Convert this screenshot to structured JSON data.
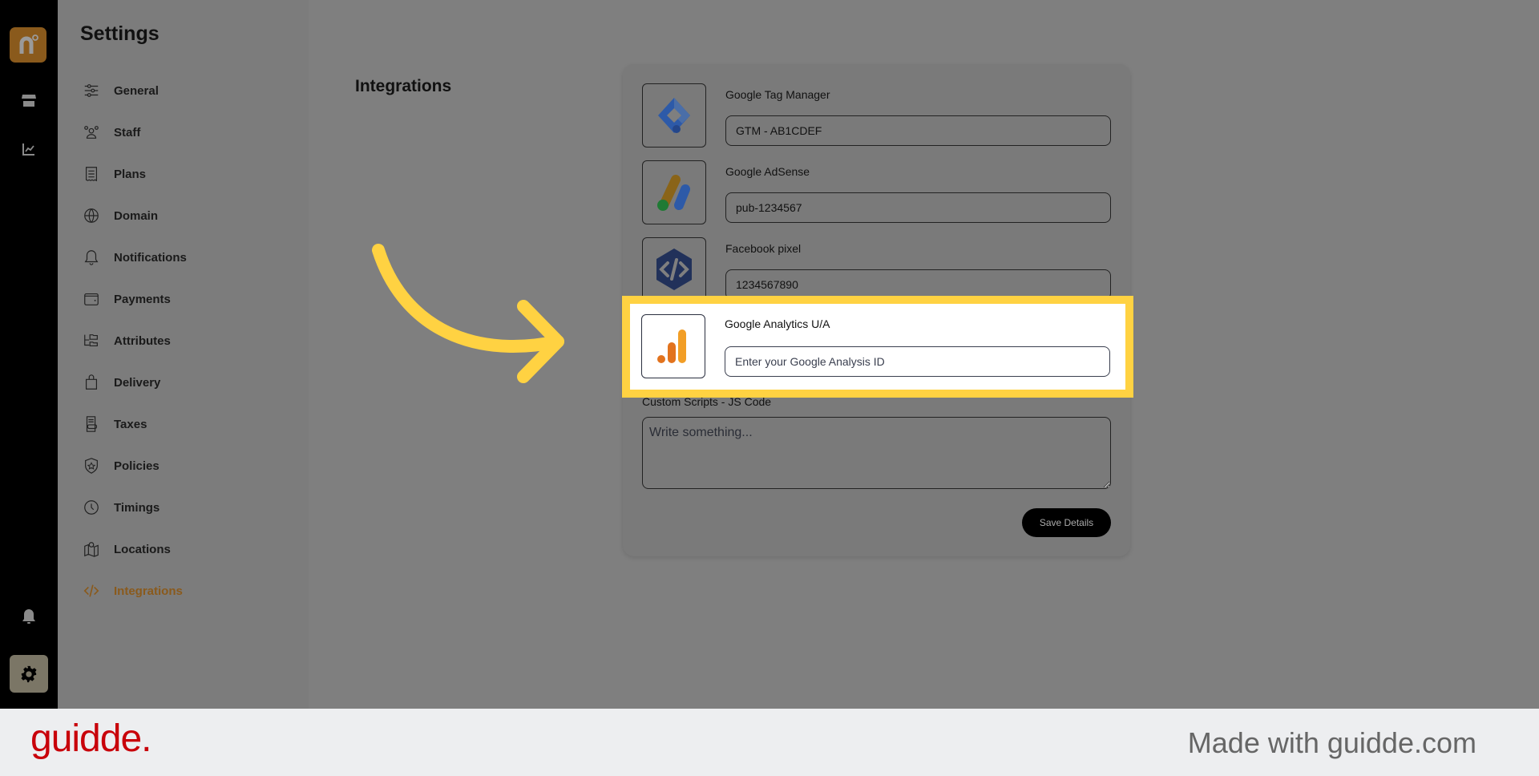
{
  "rail": {
    "logo_letter": "n",
    "icons": [
      "store-icon",
      "chart-icon",
      "bell-icon",
      "gear-icon"
    ]
  },
  "settings": {
    "title": "Settings",
    "items": [
      {
        "label": "General",
        "icon": "sliders-icon"
      },
      {
        "label": "Staff",
        "icon": "users-icon"
      },
      {
        "label": "Plans",
        "icon": "receipt-icon"
      },
      {
        "label": "Domain",
        "icon": "globe-icon"
      },
      {
        "label": "Notifications",
        "icon": "bell-icon"
      },
      {
        "label": "Payments",
        "icon": "wallet-icon"
      },
      {
        "label": "Attributes",
        "icon": "folders-icon"
      },
      {
        "label": "Delivery",
        "icon": "bag-icon"
      },
      {
        "label": "Taxes",
        "icon": "tax-document-icon"
      },
      {
        "label": "Policies",
        "icon": "shield-star-icon"
      },
      {
        "label": "Timings",
        "icon": "clock-icon"
      },
      {
        "label": "Locations",
        "icon": "map-pin-icon"
      },
      {
        "label": "Integrations",
        "icon": "code-icon",
        "active": true
      }
    ]
  },
  "main": {
    "title": "Integrations",
    "integrations": [
      {
        "label": "Google Tag Manager",
        "value": "GTM - AB1CDEF",
        "placeholder": ""
      },
      {
        "label": "Google AdSense",
        "value": "pub-1234567",
        "placeholder": ""
      },
      {
        "label": "Facebook pixel",
        "value": "1234567890",
        "placeholder": ""
      },
      {
        "label": "Google Analytics U/A",
        "value": "",
        "placeholder": "Enter your Google Analysis ID"
      }
    ],
    "custom_scripts": {
      "label": "Custom Scripts - JS Code",
      "placeholder": "Write something..."
    },
    "save_label": "Save Details"
  },
  "colors": {
    "accent": "#8a5a1c",
    "highlight": "#ffd242"
  },
  "footer": {
    "brand": "guidde.",
    "made_with": "Made with guidde.com"
  }
}
